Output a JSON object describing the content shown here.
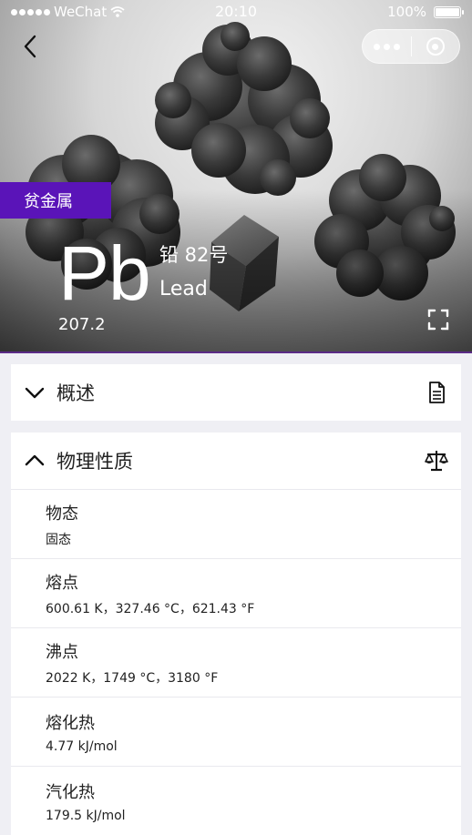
{
  "status_bar": {
    "carrier": "WeChat",
    "time": "20:10",
    "battery": "100%"
  },
  "header": {
    "back_icon": "chevron-left-icon",
    "more_icon": "more-dots-icon",
    "close_icon": "target-circle-icon"
  },
  "element": {
    "category": "贫金属",
    "symbol": "Pb",
    "chinese_name_number": "铅 82号",
    "english_name": "Lead",
    "atomic_mass": "207.2"
  },
  "colors": {
    "accent": "#5a14b8",
    "hero_divider": "#5a2a86",
    "background": "#efeff4"
  },
  "sections": {
    "overview": {
      "title": "概述",
      "expanded": false,
      "icon": "document-icon"
    },
    "physical": {
      "title": "物理性质",
      "expanded": true,
      "icon": "balance-scale-icon",
      "properties": [
        {
          "label": "物态",
          "value": "固态"
        },
        {
          "label": "熔点",
          "value": "600.61 K，327.46 °C，621.43 °F"
        },
        {
          "label": "沸点",
          "value": "2022 K，1749 °C，3180 °F"
        },
        {
          "label": "熔化热",
          "value": "4.77 kJ/mol"
        },
        {
          "label": "汽化热",
          "value": "179.5 kJ/mol"
        }
      ]
    }
  }
}
